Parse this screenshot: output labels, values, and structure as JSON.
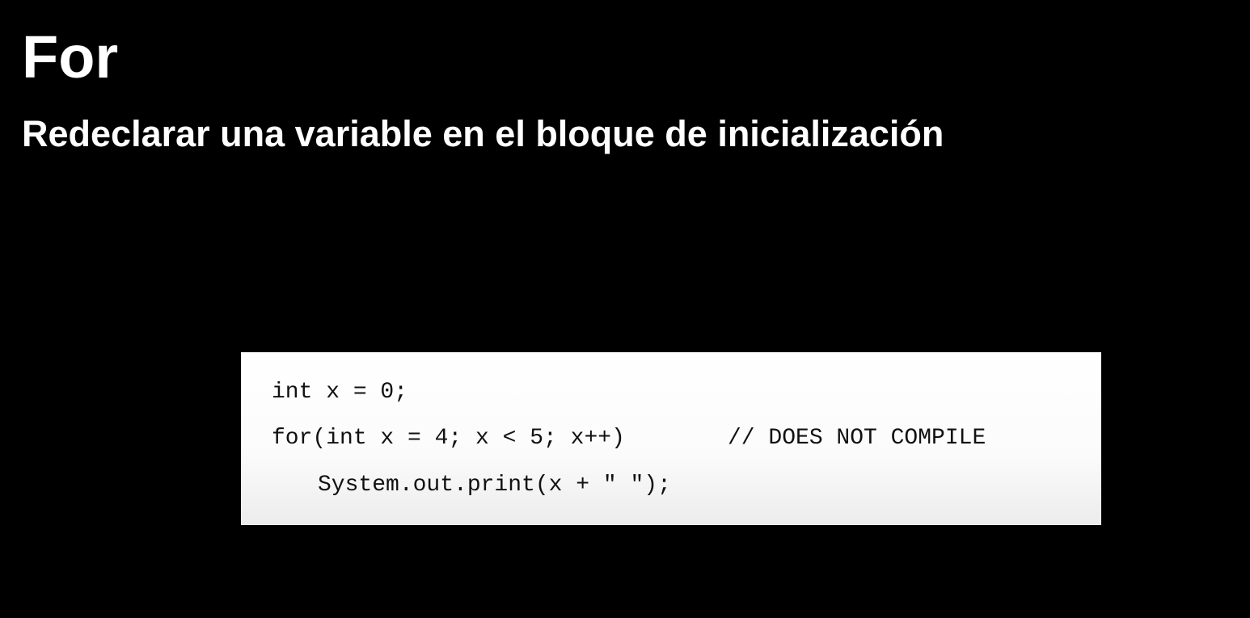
{
  "slide": {
    "title": "For",
    "subtitle": "Redeclarar una variable en el bloque de inicialización",
    "background_color": "#000000",
    "text_color": "#ffffff"
  },
  "code": {
    "background_color": "#ffffff",
    "lines": [
      "int x = 0;",
      "for(int x = 4; x < 5; x++)",
      "System.out.print(x + \" \");"
    ],
    "comment": "// DOES NOT COMPILE"
  }
}
